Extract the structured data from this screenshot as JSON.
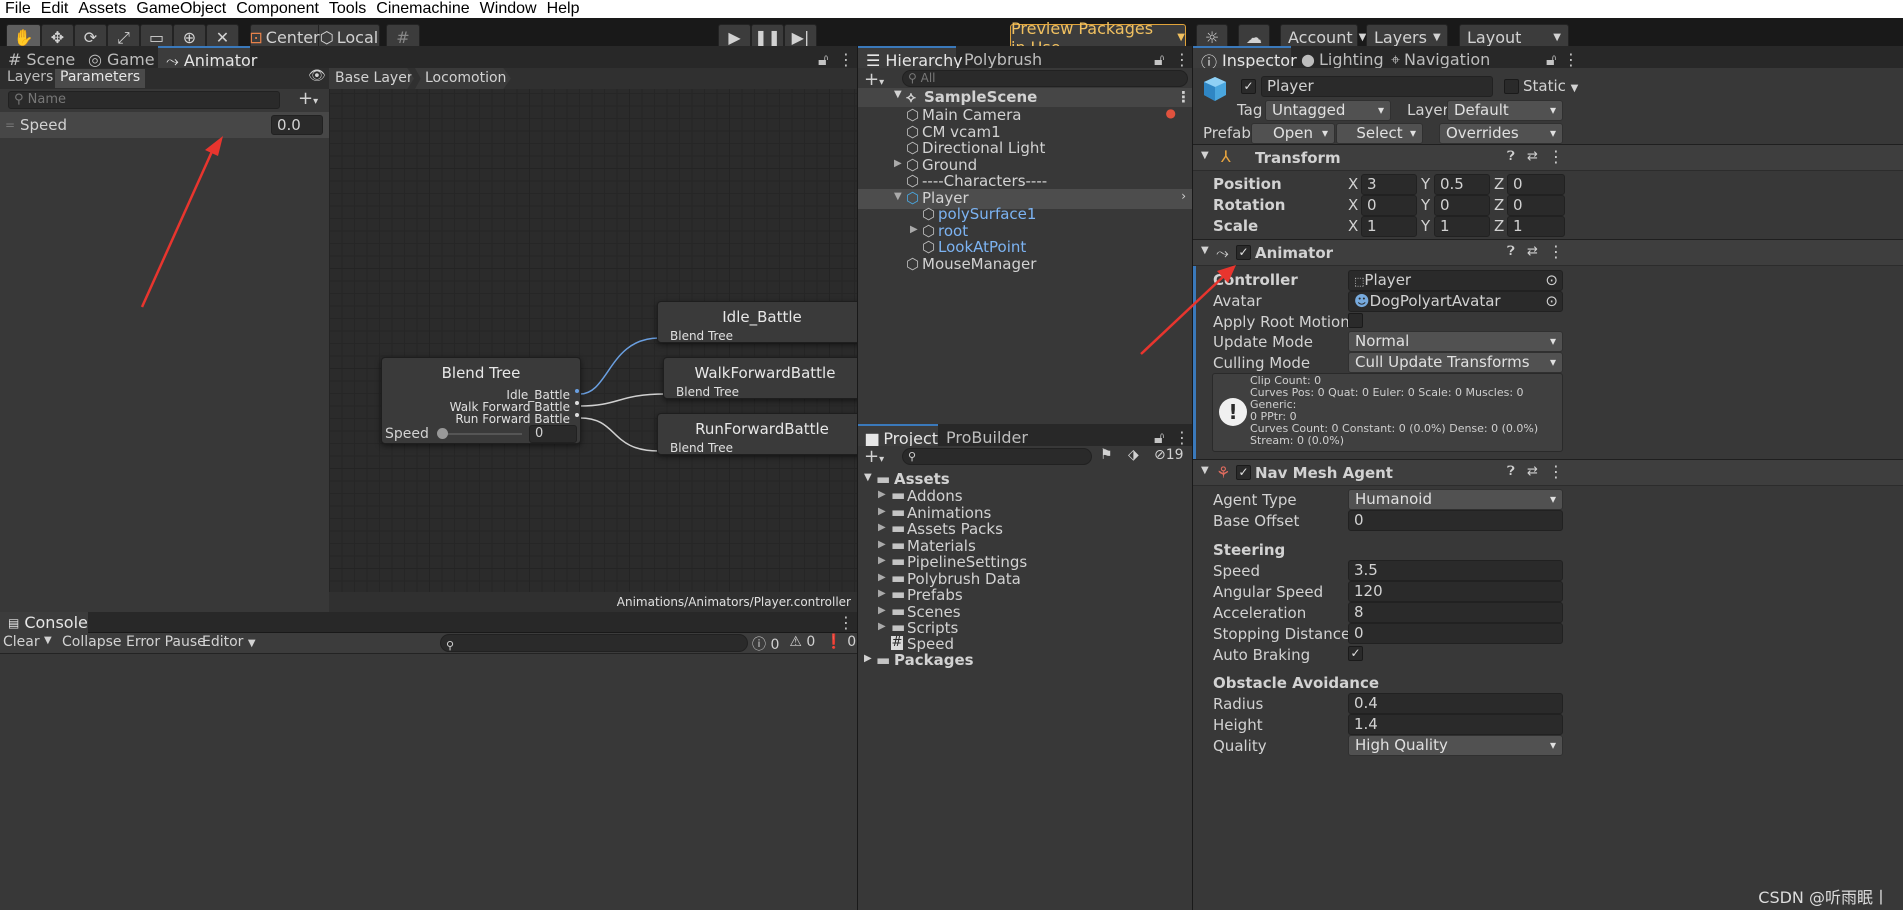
{
  "menu": [
    "File",
    "Edit",
    "Assets",
    "GameObject",
    "Component",
    "Tools",
    "Cinemachine",
    "Window",
    "Help"
  ],
  "toolbar": {
    "center_label": "Center",
    "local_label": "Local",
    "preview_packages": "Preview Packages in Use",
    "account": "Account",
    "layers": "Layers",
    "layout": "Layout"
  },
  "left_tabs": {
    "scene": "Scene",
    "game": "Game",
    "animator": "Animator"
  },
  "animator": {
    "layers_tab": "Layers",
    "parameters_tab": "Parameters",
    "search_placeholder": "Name",
    "param_name": "Speed",
    "param_value": "0.0",
    "breadcrumb": [
      "Base Layer",
      "Locomotion"
    ],
    "footer_path": "Animations/Animators/Player.controller",
    "blend_tree": {
      "title": "Blend Tree",
      "motions": [
        "Idle_Battle",
        "Walk Forward Battle",
        "Run Forward Battle"
      ],
      "param_label": "Speed",
      "param_value": "0"
    },
    "children": [
      {
        "title": "Idle_Battle",
        "sub": "Blend Tree"
      },
      {
        "title": "WalkForwardBattle",
        "sub": "Blend Tree"
      },
      {
        "title": "RunForwardBattle",
        "sub": "Blend Tree"
      }
    ]
  },
  "console": {
    "tab": "Console",
    "clear": "Clear",
    "collapse": "Collapse",
    "error_pause": "Error Pause",
    "editor": "Editor",
    "count_info": "0",
    "count_warn": "0",
    "count_error": "0"
  },
  "hierarchy": {
    "tab": "Hierarchy",
    "tab2": "Polybrush",
    "search_placeholder": "All",
    "scene": "SampleScene",
    "items": [
      {
        "label": "Main Camera",
        "depth": 1,
        "arrow": "",
        "blue": false
      },
      {
        "label": "CM vcam1",
        "depth": 1,
        "arrow": "",
        "blue": false
      },
      {
        "label": "Directional Light",
        "depth": 1,
        "arrow": "",
        "blue": false
      },
      {
        "label": "Ground",
        "depth": 1,
        "arrow": "▶",
        "blue": false
      },
      {
        "label": "----Characters----",
        "depth": 1,
        "arrow": "",
        "blue": false
      },
      {
        "label": "Player",
        "depth": 1,
        "arrow": "▼",
        "blue": false
      },
      {
        "label": "polySurface1",
        "depth": 2,
        "arrow": "",
        "blue": true
      },
      {
        "label": "root",
        "depth": 2,
        "arrow": "▶",
        "blue": true
      },
      {
        "label": "LookAtPoint",
        "depth": 2,
        "arrow": "",
        "blue": true
      },
      {
        "label": "MouseManager",
        "depth": 1,
        "arrow": "",
        "blue": false
      }
    ]
  },
  "project": {
    "tab": "Project",
    "tab2": "ProBuilder",
    "hidden_count": "19",
    "root": "Assets",
    "folders": [
      "Addons",
      "Animations",
      "Assets Packs",
      "Materials",
      "PipelineSettings",
      "Polybrush Data",
      "Prefabs",
      "Scenes",
      "Scripts"
    ],
    "script": "Speed",
    "packages": "Packages"
  },
  "inspector": {
    "tabs": [
      "Inspector",
      "Lighting",
      "Navigation"
    ],
    "object_name": "Player",
    "static_label": "Static",
    "tag_label": "Tag",
    "tag_value": "Untagged",
    "layer_label": "Layer",
    "layer_value": "Default",
    "prefab_label": "Prefab",
    "open": "Open",
    "select": "Select",
    "overrides": "Overrides",
    "transform": {
      "title": "Transform",
      "position_label": "Position",
      "pos": [
        "3",
        "0.5",
        "0"
      ],
      "rotation_label": "Rotation",
      "rot": [
        "0",
        "0",
        "0"
      ],
      "scale_label": "Scale",
      "scale": [
        "1",
        "1",
        "1"
      ]
    },
    "animator": {
      "title": "Animator",
      "controller_label": "Controller",
      "controller": "Player",
      "avatar_label": "Avatar",
      "avatar": "DogPolyartAvatar",
      "root_motion_label": "Apply Root Motion",
      "update_mode_label": "Update Mode",
      "update_mode": "Normal",
      "culling_mode_label": "Culling Mode",
      "culling_mode": "Cull Update Transforms",
      "info": [
        "Clip Count: 0",
        "Curves Pos: 0 Quat: 0 Euler: 0 Scale: 0 Muscles: 0 Generic:",
        "0 PPtr: 0",
        "Curves Count: 0 Constant: 0 (0.0%) Dense: 0 (0.0%)",
        "Stream: 0 (0.0%)"
      ]
    },
    "navmesh": {
      "title": "Nav Mesh Agent",
      "agent_type_label": "Agent Type",
      "agent_type": "Humanoid",
      "base_offset_label": "Base Offset",
      "base_offset": "0",
      "steering": "Steering",
      "speed_label": "Speed",
      "speed": "3.5",
      "angular_label": "Angular Speed",
      "angular": "120",
      "accel_label": "Acceleration",
      "accel": "8",
      "stopping_label": "Stopping Distance",
      "stopping": "0",
      "braking_label": "Auto Braking",
      "avoidance": "Obstacle Avoidance",
      "radius_label": "Radius",
      "radius": "0.4",
      "height_label": "Height",
      "height": "1.4",
      "quality_label": "Quality",
      "quality": "High Quality"
    }
  },
  "watermark": "CSDN @听雨眠丨",
  "colors": {
    "accent": "#3a79bb",
    "annotation_arrow": "#e8352e",
    "preview_border": "#e0a33a"
  }
}
